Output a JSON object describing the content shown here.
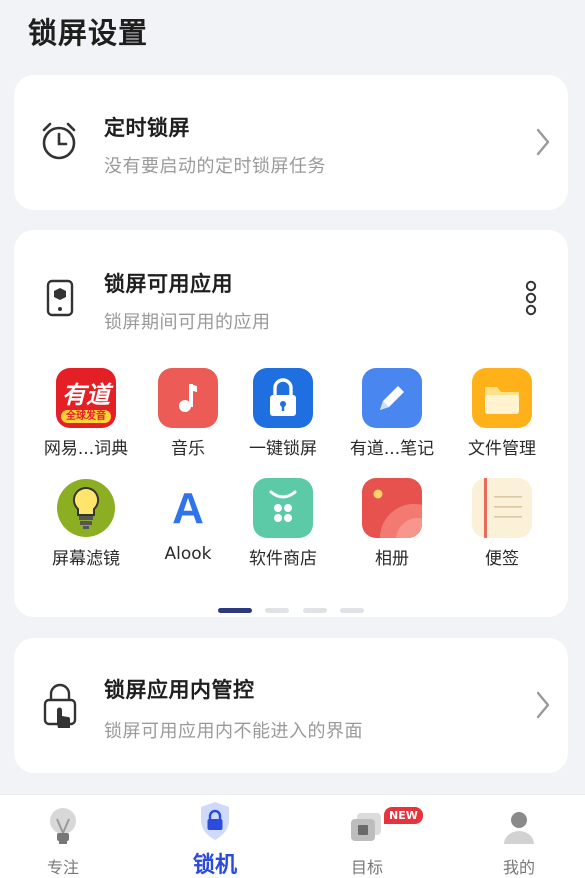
{
  "page_title": "锁屏设置",
  "timed_lock": {
    "title": "定时锁屏",
    "subtitle": "没有要启动的定时锁屏任务",
    "icon": "alarm-clock-icon"
  },
  "available_apps": {
    "title": "锁屏可用应用",
    "subtitle": "锁屏期间可用的应用",
    "icon": "phone-box-icon",
    "apps": [
      {
        "label": "网易...词典",
        "icon": "youdao-dict-icon"
      },
      {
        "label": "音乐",
        "icon": "music-icon"
      },
      {
        "label": "一键锁屏",
        "icon": "lock-icon"
      },
      {
        "label": "有道...笔记",
        "icon": "youdao-note-icon"
      },
      {
        "label": "文件管理",
        "icon": "folder-icon"
      },
      {
        "label": "屏幕滤镜",
        "icon": "bulb-icon"
      },
      {
        "label": "Alook",
        "icon": "alook-icon"
      },
      {
        "label": "软件商店",
        "icon": "app-store-icon"
      },
      {
        "label": "相册",
        "icon": "gallery-icon"
      },
      {
        "label": "便签",
        "icon": "notes-icon"
      }
    ],
    "youdao_logo_text": "有道",
    "youdao_banner_text": "全球发音",
    "alook_letter": "A",
    "page_indicator": {
      "pages": 4,
      "current": 1
    }
  },
  "in_app_control": {
    "title": "锁屏应用内管控",
    "subtitle": "锁屏可用应用内不能进入的界面",
    "icon": "lock-hand-icon"
  },
  "bottom_nav": {
    "items": [
      {
        "label": "专注",
        "icon": "lightbulb-icon",
        "active": false
      },
      {
        "label": "锁机",
        "icon": "shield-lock-icon",
        "active": true
      },
      {
        "label": "目标",
        "icon": "target-icon",
        "active": false,
        "badge": "NEW"
      },
      {
        "label": "我的",
        "icon": "person-icon",
        "active": false
      }
    ]
  },
  "colors": {
    "accent": "#2b4bdc",
    "background": "#f2f3f6",
    "indicator_active": "#2d3a7d"
  }
}
